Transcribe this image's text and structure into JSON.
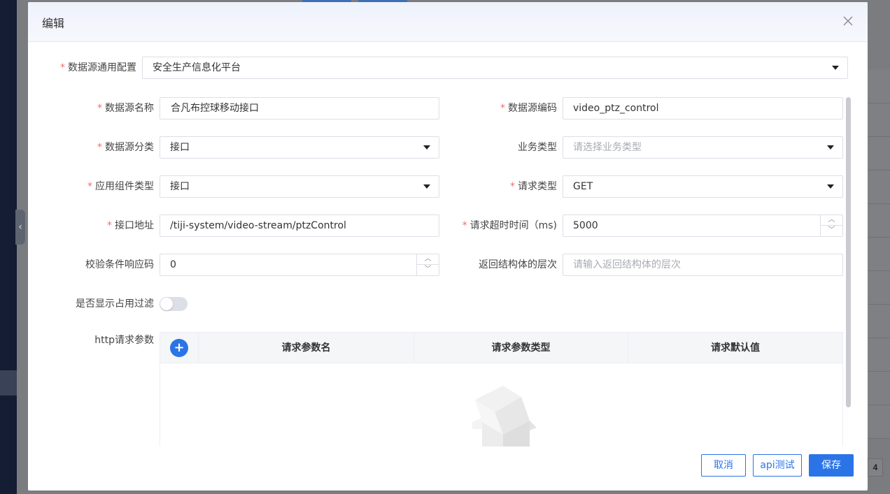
{
  "dialog": {
    "title": "编辑",
    "close_icon": "close-icon"
  },
  "form": {
    "general_config": {
      "label": "数据源通用配置",
      "value": "安全生产信息化平台"
    },
    "name": {
      "label": "数据源名称",
      "value": "合凡布控球移动接口"
    },
    "code": {
      "label": "数据源编码",
      "value": "video_ptz_control"
    },
    "category": {
      "label": "数据源分类",
      "value": "接口"
    },
    "business_type": {
      "label": "业务类型",
      "placeholder": "请选择业务类型"
    },
    "component_type": {
      "label": "应用组件类型",
      "value": "接口"
    },
    "request_type": {
      "label": "请求类型",
      "value": "GET"
    },
    "api_address": {
      "label": "接口地址",
      "value": "/tiji-system/video-stream/ptzControl"
    },
    "timeout": {
      "label": "请求超时时间（ms)",
      "value": "5000"
    },
    "response_code": {
      "label": "校验条件响应码",
      "value": "0"
    },
    "structure_level": {
      "label": "返回结构体的层次",
      "placeholder": "请输入返回结构体的层次"
    },
    "show_filter": {
      "label": "是否显示占用过滤",
      "checked": false
    },
    "http_params": {
      "label": "http请求参数",
      "add_icon": "plus-icon",
      "columns": [
        "请求参数名",
        "请求参数类型",
        "请求默认值"
      ]
    }
  },
  "footer": {
    "cancel": "取消",
    "api_test": "api测试",
    "save": "保存"
  },
  "background": {
    "page_number": "4"
  }
}
